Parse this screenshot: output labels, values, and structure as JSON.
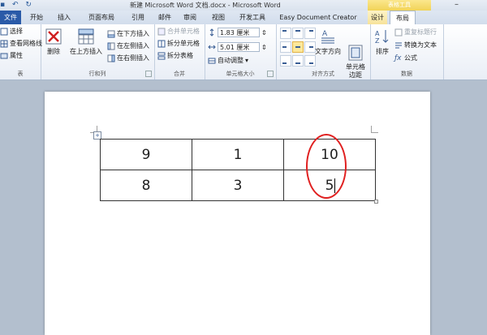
{
  "window": {
    "title": "新建 Microsoft Word 文档.docx - Microsoft Word",
    "context_header": "表格工具",
    "minimize": "–"
  },
  "tabs": [
    "文件",
    "开始",
    "插入",
    "页面布局",
    "引用",
    "邮件",
    "审阅",
    "视图",
    "开发工具",
    "Easy Document Creator",
    "设计",
    "布局"
  ],
  "active_tab": "布局",
  "ribbon": {
    "table_group": {
      "label": "表",
      "items": [
        "选择",
        "查看网格线",
        "属性"
      ]
    },
    "rows_cols": {
      "label": "行和列",
      "delete": "删除",
      "insert_above": "在上方插入",
      "insert_below": "在下方插入",
      "insert_left": "在左侧插入",
      "insert_right": "在右侧插入"
    },
    "merge": {
      "label": "合并",
      "merge_cells": "合并单元格",
      "split_cells": "拆分单元格",
      "split_table": "拆分表格"
    },
    "cell_size": {
      "label": "单元格大小",
      "height_value": "1.83 厘米",
      "width_value": "5.01 厘米",
      "autofit": "自动调整"
    },
    "alignment": {
      "label": "对齐方式",
      "text_direction": "文字方向",
      "cell_margins": "单元格\n边距"
    },
    "data": {
      "label": "数据",
      "sort": "排序",
      "repeat_header": "重复标题行",
      "convert_to_text": "转换为文本",
      "formula": "公式"
    }
  },
  "document": {
    "table": [
      [
        "9",
        "1",
        "10"
      ],
      [
        "8",
        "3",
        "5"
      ]
    ]
  },
  "colors": {
    "file_tab": "#2a5aa8",
    "annotation": "#e02020",
    "context": "#f1d357"
  }
}
